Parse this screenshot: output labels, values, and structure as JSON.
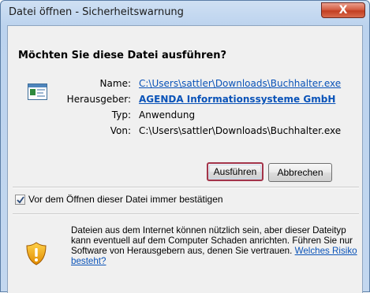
{
  "window": {
    "title": "Datei öffnen - Sicherheitswarnung",
    "close_glyph": "X"
  },
  "dialog": {
    "heading": "Möchten Sie diese Datei ausführen?",
    "app_icon": "executable-window-icon",
    "fields": {
      "name_label": "Name:",
      "name_value": "C:\\Users\\sattler\\Downloads\\Buchhalter.exe",
      "publisher_label": "Herausgeber:",
      "publisher_value": "AGENDA Informationssysteme GmbH",
      "type_label": "Typ:",
      "type_value": "Anwendung",
      "from_label": "Von:",
      "from_value": "C:\\Users\\sattler\\Downloads\\Buchhalter.exe"
    },
    "buttons": {
      "run_label": "Ausführen",
      "cancel_label": "Abbrechen"
    },
    "checkbox": {
      "label": "Vor dem Öffnen dieser Datei immer bestätigen",
      "checked": true
    },
    "warning": {
      "icon": "shield-warning-icon",
      "text": "Dateien aus dem Internet können nützlich sein, aber dieser Dateityp kann eventuell auf dem Computer Schaden anrichten. Führen Sie nur Software von Herausgebern aus, denen Sie vertrauen.",
      "link_label": "Welches Risiko besteht?"
    }
  },
  "colors": {
    "link": "#0a53b8",
    "default_button_border": "#a3344a",
    "close_button": "#c33f22",
    "frame": "#bcd3ee"
  }
}
